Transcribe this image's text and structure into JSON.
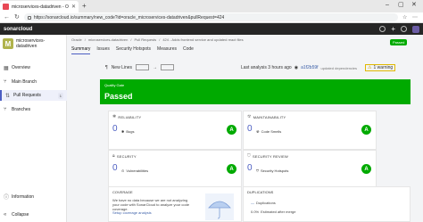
{
  "browser": {
    "tab_title": "microservices-datadriven - Overv...",
    "url": "https://sonarcloud.io/summary/new_code?id=oracle_microservices-datadriven&pullRequest=424"
  },
  "app": {
    "logo": "sonarcloud"
  },
  "sidebar": {
    "project_initial": "M",
    "project_name": "microservices-datadriven",
    "items": [
      {
        "label": "Overview"
      },
      {
        "label": "Main Branch"
      },
      {
        "label": "Pull Requests",
        "count": "1"
      },
      {
        "label": "Branches"
      }
    ],
    "bottom": [
      {
        "label": "Information"
      },
      {
        "label": "Collapse"
      }
    ]
  },
  "breadcrumb": [
    "Oracle",
    "microservices-datadriven",
    "Pull Requests"
  ],
  "pr": {
    "title": "424 - Adds frontend service and updated react files",
    "status": "Passed"
  },
  "tabs": [
    "Summary",
    "Issues",
    "Security Hotspots",
    "Measures",
    "Code"
  ],
  "stats": {
    "new_lines": "New Lines",
    "filter_label": "",
    "last_analysis": "Last analysis 3 hours ago",
    "commit_hash": "a1f2b59f",
    "commit_msg": "updated dependencies",
    "warning": "1 warning"
  },
  "quality_gate": {
    "label": "Quality Gate",
    "status": "Passed",
    "color": "#00aa00"
  },
  "cards": [
    {
      "title": "RELIABILITY",
      "value": "0",
      "sub": "Bugs",
      "grade": "A"
    },
    {
      "title": "MAINTAINABILITY",
      "value": "0",
      "sub": "Code Smells",
      "grade": "A"
    },
    {
      "title": "SECURITY",
      "value": "0",
      "sub": "Vulnerabilities",
      "grade": "A"
    },
    {
      "title": "SECURITY REVIEW",
      "value": "0",
      "sub": "Security Hotspots",
      "grade": "A"
    }
  ],
  "coverage": {
    "title": "COVERAGE",
    "text": "We have no data because we are not analyzing your code with SonarCloud to analyze your code coverage.",
    "link": "Setup coverage analysis"
  },
  "duplications": {
    "title": "DUPLICATIONS",
    "line1_value": "—",
    "line1_label": "Duplications",
    "line2_value": "0.0%",
    "line2_label": "Estimated after merge"
  },
  "colors": {
    "accent": "#4c5ec2",
    "pass": "#00aa00",
    "header": "#262626"
  }
}
